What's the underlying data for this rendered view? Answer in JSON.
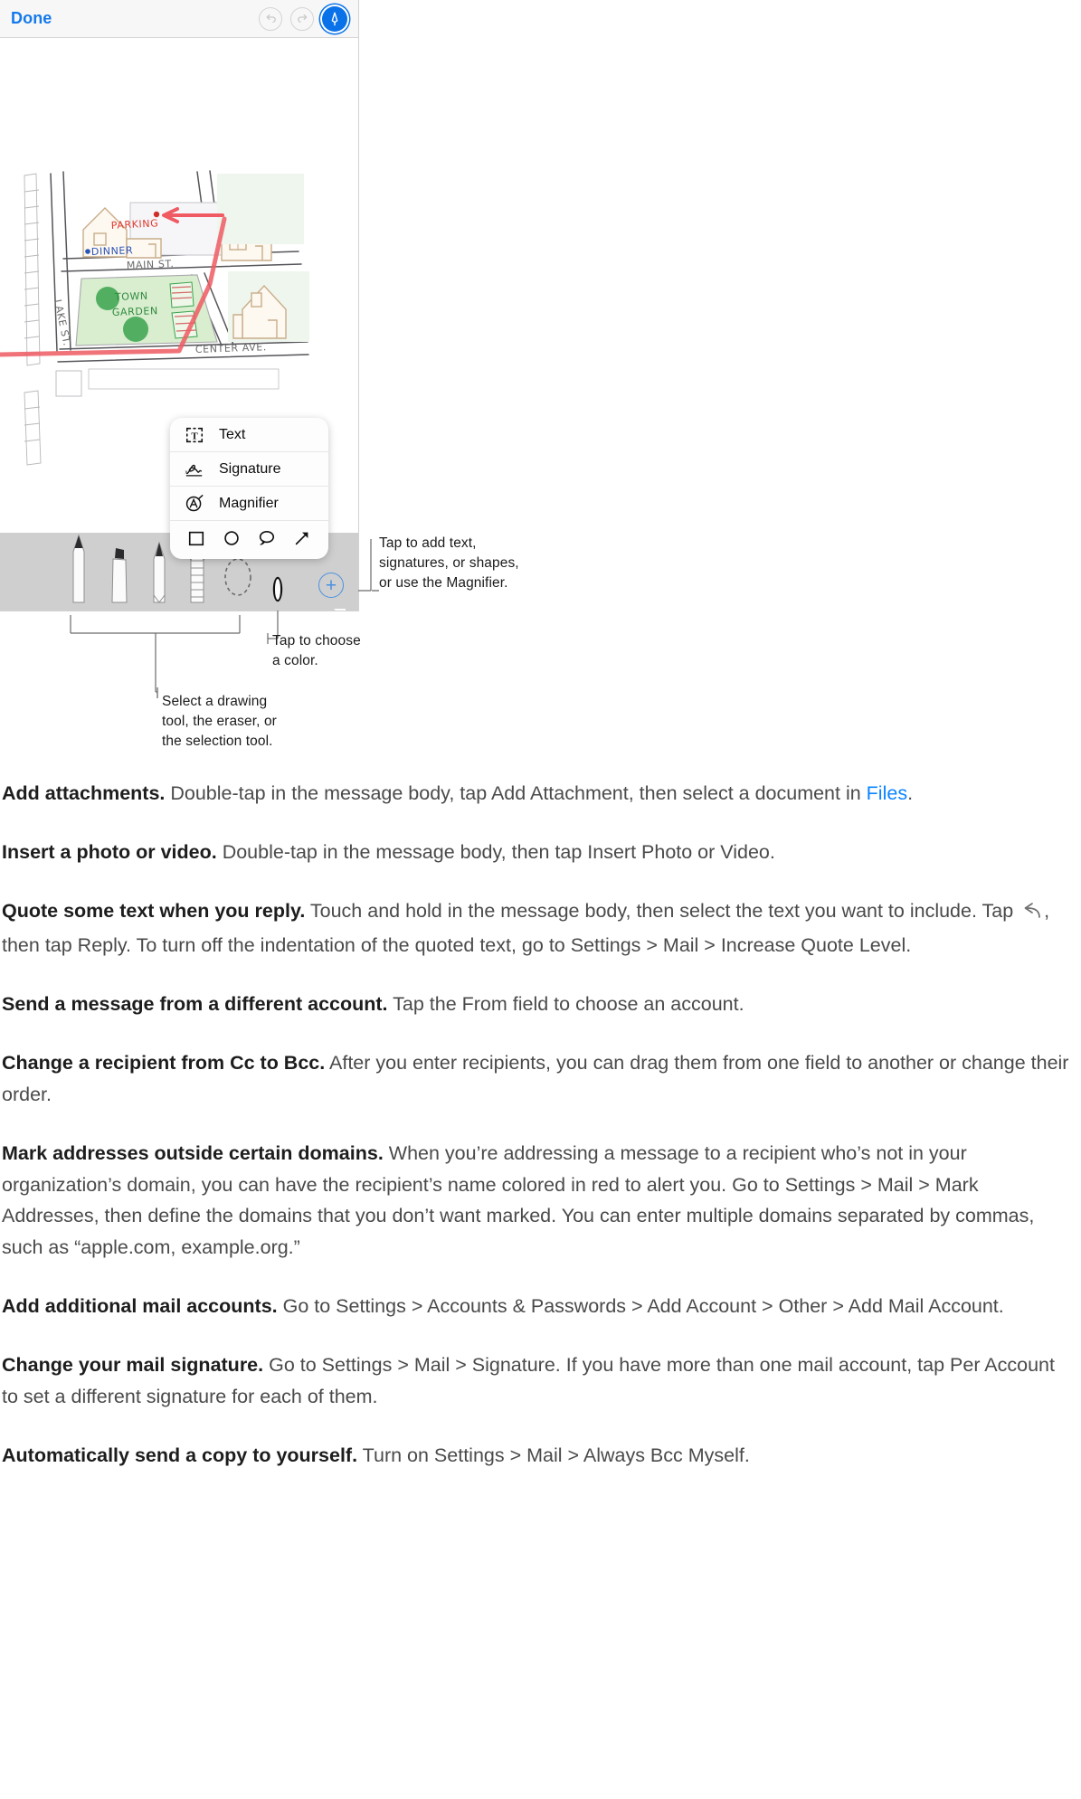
{
  "figure": {
    "device": {
      "nav": {
        "done_label": "Done",
        "undo_icon": "undo-icon",
        "redo_icon": "redo-icon",
        "markup_icon": "markup-pen-icon"
      },
      "map": {
        "labels": [
          {
            "text": "PARKING",
            "color": "#e0392f"
          },
          {
            "text": "DINNER",
            "color": "#2a54b8"
          },
          {
            "text": "MAIN ST.",
            "color": "#6b6b6b"
          },
          {
            "text": "LAKE ST.",
            "color": "#6b6b6b"
          },
          {
            "text": "TOWN",
            "color": "#2e8b3f"
          },
          {
            "text": "GARDEN",
            "color": "#2e8b3f"
          },
          {
            "text": "CENTER AVE.",
            "color": "#6b6b6b"
          }
        ],
        "route_color": "#ef5a63"
      },
      "popup": {
        "items": [
          {
            "label": "Text",
            "icon": "text-box-icon"
          },
          {
            "label": "Signature",
            "icon": "signature-icon"
          },
          {
            "label": "Magnifier",
            "icon": "magnifier-icon"
          }
        ],
        "shapes": [
          {
            "icon": "square-shape-icon"
          },
          {
            "icon": "circle-shape-icon"
          },
          {
            "icon": "speech-bubble-shape-icon"
          },
          {
            "icon": "arrow-shape-icon"
          }
        ]
      },
      "toolbar": {
        "tools": [
          {
            "icon": "pen-tool-icon"
          },
          {
            "icon": "highlighter-tool-icon"
          },
          {
            "icon": "pencil-tool-icon"
          },
          {
            "icon": "eraser-tool-icon"
          },
          {
            "icon": "lasso-selection-tool-icon"
          }
        ],
        "color_swatch": {
          "icon": "color-swatch-icon",
          "color": "#111111"
        },
        "add_button": {
          "icon": "plus-icon",
          "color": "#4a90e2"
        }
      }
    },
    "callouts": [
      {
        "lines": [
          "Tap to add text,",
          "signatures, or shapes,",
          "or use the Magnifier."
        ]
      },
      {
        "lines": [
          "Tap to choose",
          "a color."
        ]
      },
      {
        "lines": [
          "Select a drawing",
          "tool, the eraser, or",
          "the selection tool."
        ]
      }
    ]
  },
  "body": {
    "paragraphs": [
      {
        "heading": "Add attachments.",
        "before": " Double-tap in the message body, tap Add Attachment, then select a document in ",
        "link": "Files",
        "after": "."
      },
      {
        "heading": "Insert a photo or video.",
        "before": " Double-tap in the message body, then tap Insert Photo or Video."
      },
      {
        "heading": "Quote some text when you reply.",
        "before": " Touch and hold in the message body, then select the text you want to include. Tap ",
        "icon": "reply-arrow-icon",
        "after": ", then tap Reply. To turn off the indentation of the quoted text, go to Settings > Mail > Increase Quote Level."
      },
      {
        "heading": "Send a message from a different account.",
        "before": " Tap the From field to choose an account."
      },
      {
        "heading": "Change a recipient from Cc to Bcc.",
        "before": " After you enter recipients, you can drag them from one field to another or change their order."
      },
      {
        "heading": "Mark addresses outside certain domains.",
        "before": " When you’re addressing a message to a recipient who’s not in your organization’s domain, you can have the recipient’s name colored in red to alert you. Go to Settings > Mail > Mark Addresses, then define the domains that you don’t want marked. You can enter multiple domains separated by commas, such as “apple.com, example.org.”"
      },
      {
        "heading": "Add additional mail accounts.",
        "before": " Go to Settings > Accounts & Passwords > Add Account > Other > Add Mail Account."
      },
      {
        "heading": "Change your mail signature.",
        "before": " Go to Settings > Mail > Signature. If you have more than one mail account, tap Per Account to set a different signature for each of them."
      },
      {
        "heading": "Automatically send a copy to yourself.",
        "before": " Turn on Settings > Mail > Always Bcc Myself."
      }
    ]
  },
  "colors": {
    "link": "#0a84ff",
    "accent_blue": "#0a72e8",
    "toolbar_gray": "#cfcfcf"
  }
}
